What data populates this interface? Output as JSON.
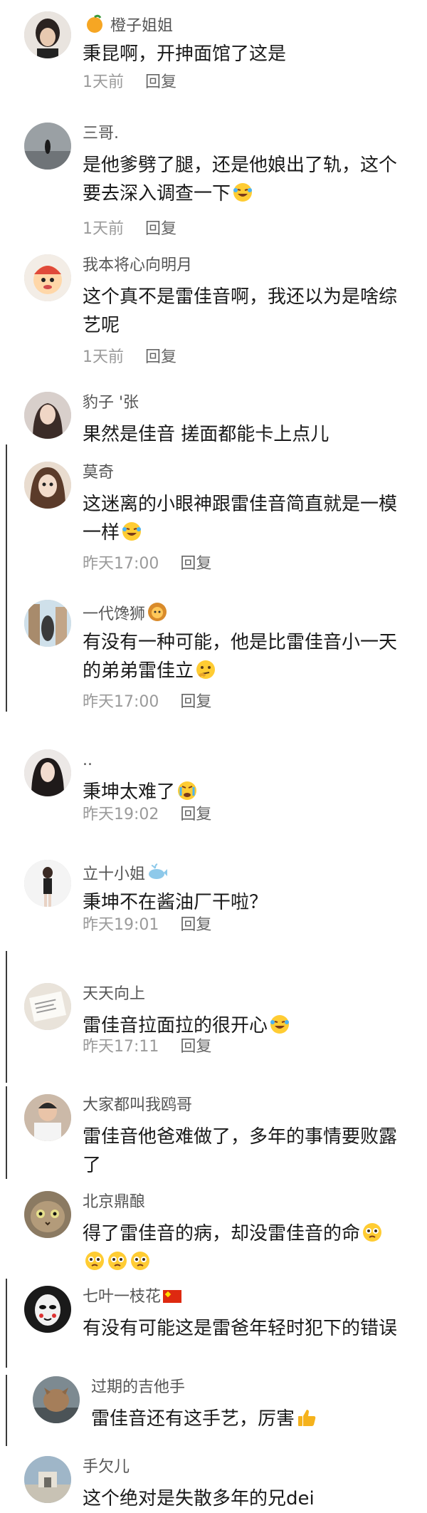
{
  "comments": [
    {
      "name": "橙子姐姐",
      "text": "秉昆啊，开抻面馆了这是",
      "time": "1天前",
      "reply": "回复"
    },
    {
      "name": "三哥.",
      "text": "是他爹劈了腿，还是他娘出了轨，这个要去深入调查一下",
      "time": "1天前",
      "reply": "回复"
    },
    {
      "name": "我本将心向明月",
      "text": "这个真不是雷佳音啊，我还以为是啥综艺呢",
      "time": "1天前",
      "reply": "回复"
    },
    {
      "name": "豹子 '张",
      "text": "果然是佳音 搓面都能卡上点儿"
    },
    {
      "name": "莫奇",
      "text": "这迷离的小眼神跟雷佳音简直就是一模一样",
      "time": "昨天17:00",
      "reply": "回复"
    },
    {
      "name": "一代馋狮",
      "text": "有没有一种可能，他是比雷佳音小一天的弟弟雷佳立",
      "time": "昨天17:00",
      "reply": "回复"
    },
    {
      "name": "..",
      "text": "秉坤太难了",
      "time": "昨天19:02",
      "reply": "回复"
    },
    {
      "name": "立十小姐",
      "text": "秉坤不在酱油厂干啦？",
      "time": "昨天19:01",
      "reply": "回复"
    },
    {
      "name": "天天向上",
      "text": "雷佳音拉面拉的很开心",
      "time": "昨天17:11",
      "reply": "回复"
    },
    {
      "name": "大家都叫我鸥哥",
      "text": "雷佳音他爸难做了，多年的事情要败露了"
    },
    {
      "name": "北京鼎酿",
      "text": "得了雷佳音的病，却没雷佳音的命"
    },
    {
      "name": "七叶一枝花",
      "text": "有没有可能这是雷爸年轻时犯下的错误"
    },
    {
      "name": "过期的吉他手",
      "text": "雷佳音还有这手艺，厉害"
    },
    {
      "name": "手欠儿",
      "text": "这个绝对是失散多年的兄dei"
    }
  ]
}
